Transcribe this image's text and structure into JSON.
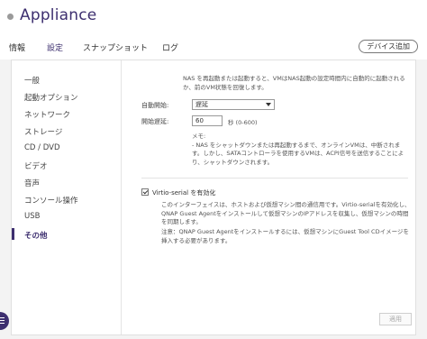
{
  "window": {
    "title": "Appliance"
  },
  "tabs": [
    {
      "label": "情報"
    },
    {
      "label": "設定"
    },
    {
      "label": "スナップショット"
    },
    {
      "label": "ログ"
    }
  ],
  "header": {
    "add_device_label": "デバイス追加"
  },
  "sidebar": {
    "items": [
      {
        "label": "一般"
      },
      {
        "label": "起動オプション"
      },
      {
        "label": "ネットワーク"
      },
      {
        "label": "ストレージ"
      },
      {
        "label": "CD / DVD"
      },
      {
        "label": "ビデオ"
      },
      {
        "label": "音声"
      },
      {
        "label": "コンソール操作"
      },
      {
        "label": "USB"
      },
      {
        "label": "その他"
      }
    ],
    "active_index": 9
  },
  "main": {
    "description": "NAS を再起動または起動すると、VMはNAS起動の設定時間内に自動的に起動されるか、前のVM状態を回復します。",
    "autostart": {
      "label": "自動開始:",
      "value": "遅延"
    },
    "delay": {
      "label": "開始遅延:",
      "value": "60",
      "unit": "秒 (0-600)"
    },
    "memo": {
      "title": "メモ:",
      "text": "- NAS をシャットダウンまたは再起動するまで、オンラインVMは、中断されます。しかし、SATAコントローラを使用するVMは、ACPI信号を送信することにより、シャットダウンされます。"
    },
    "virtio": {
      "checkbox_label": "Virtio-serial を有効化",
      "checked": true,
      "description": "このインターフェイスは、ホストおよび仮想マシン間の通信用です。Virtio-serialを有効化し、QNAP Guest Agentをインストールして仮想マシンのIPアドレスを収集し、仮想マシンの時間を同期します。",
      "note": "注意：QNAP Guest Agentをインストールするには、仮想マシンにGuest Tool CDイメージを挿入する必要があります。"
    },
    "apply_label": "適用"
  },
  "colors": {
    "accent": "#3d2f6f",
    "background": "#f3f3f3"
  }
}
